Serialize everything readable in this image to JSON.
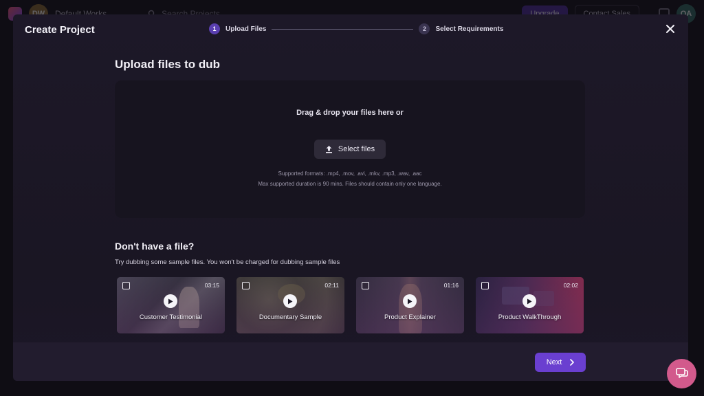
{
  "background": {
    "workspace_initials": "DW",
    "workspace_name": "Default Works...",
    "search_placeholder": "Search Projects",
    "upgrade_label": "Upgrade",
    "contact_sales_label": "Contact Sales",
    "user_initials": "QA"
  },
  "modal": {
    "title": "Create Project",
    "steps": [
      {
        "number": "1",
        "label": "Upload Files",
        "state": "active"
      },
      {
        "number": "2",
        "label": "Select Requirements",
        "state": "inactive"
      }
    ],
    "upload": {
      "heading": "Upload files to dub",
      "drop_prompt": "Drag & drop your files here or",
      "select_button": "Select files",
      "formats_text": "Supported formats: .mp4, .mov, .avi, .mkv, .mp3, .wav, .aac",
      "duration_text": "Max supported duration is 90 mins. Files should contain only one language."
    },
    "samples": {
      "heading": "Don't have a file?",
      "description": "Try dubbing some sample files. You won't be charged for dubbing sample files",
      "items": [
        {
          "label": "Customer Testimonial",
          "duration": "03:15"
        },
        {
          "label": "Documentary Sample",
          "duration": "02:11"
        },
        {
          "label": "Product Explainer",
          "duration": "01:16"
        },
        {
          "label": "Product WalkThrough",
          "duration": "02:02"
        }
      ]
    },
    "next_button": "Next"
  },
  "colors": {
    "accent": "#6a3fd0",
    "step_active": "#5a3fb0",
    "chat_fab": "#d25a8c"
  }
}
